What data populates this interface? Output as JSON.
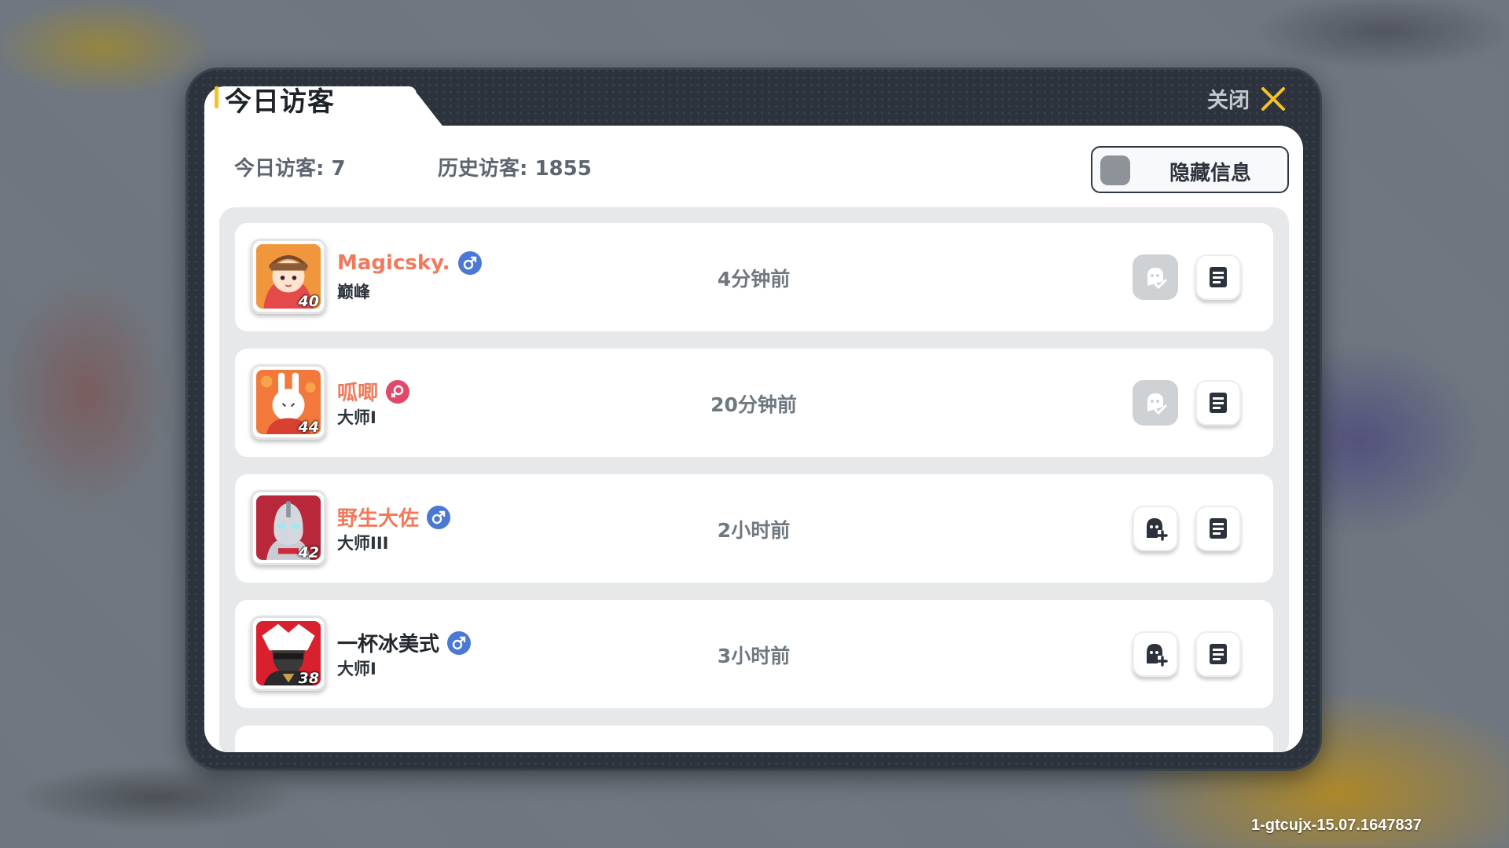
{
  "dialog": {
    "title": "今日访客",
    "close_label": "关闭",
    "today_visitors": "今日访客: 7",
    "history_visitors": "历史访客: 1855",
    "hide_info_label": "隐藏信息",
    "hide_info_enabled": false
  },
  "visitors": [
    {
      "name": "Magicsky.",
      "gender": "male",
      "rank": "巅峰",
      "level": "40",
      "time": "4分钟前",
      "friend_status": "added"
    },
    {
      "name": "呱唧",
      "gender": "female",
      "rank": "大师I",
      "level": "44",
      "time": "20分钟前",
      "friend_status": "added"
    },
    {
      "name": "野生大佐",
      "gender": "male",
      "rank": "大师III",
      "level": "42",
      "time": "2小时前",
      "friend_status": "add"
    },
    {
      "name": "一杯冰美式",
      "gender": "male",
      "rank": "大师I",
      "level": "38",
      "time": "3小时前",
      "friend_status": "add"
    }
  ],
  "colors": {
    "accent_yellow": "#f5c324",
    "name_highlight": "#f07a5c",
    "male_badge": "#4a78d4",
    "female_badge": "#e04a6a"
  },
  "version": "1-gtcujx-15.07.1647837"
}
